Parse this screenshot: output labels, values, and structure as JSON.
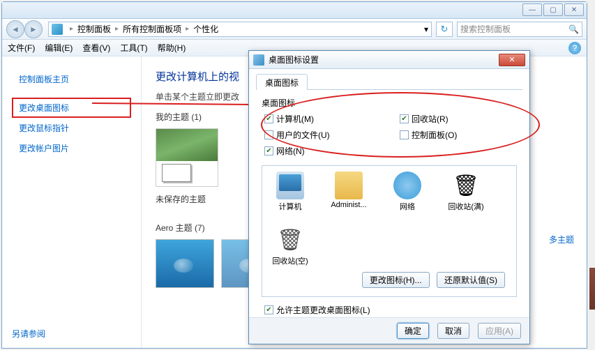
{
  "window": {
    "min": "—",
    "max": "▢",
    "close": "✕"
  },
  "breadcrumb": {
    "items": [
      "控制面板",
      "所有控制面板项",
      "个性化"
    ],
    "dropdown": "▾"
  },
  "search": {
    "placeholder": "搜索控制面板"
  },
  "menu": {
    "file": "文件(F)",
    "edit": "编辑(E)",
    "view": "查看(V)",
    "tools": "工具(T)",
    "help": "帮助(H)"
  },
  "sidebar": {
    "items": [
      {
        "label": "控制面板主页"
      },
      {
        "label": "更改桌面图标"
      },
      {
        "label": "更改鼠标指针"
      },
      {
        "label": "更改帐户图片"
      }
    ],
    "see_also": "另请参阅"
  },
  "page": {
    "title": "更改计算机上的视",
    "subtitle": "单击某个主题立即更改",
    "my_themes": "我的主题 (1)",
    "unsaved": "未保存的主题",
    "aero": "Aero 主题 (7)",
    "more_link": "多主题"
  },
  "dialog": {
    "title": "桌面图标设置",
    "tab": "桌面图标",
    "group": "桌面图标",
    "checkboxes": {
      "computer": {
        "label": "计算机(M)",
        "checked": true
      },
      "recycle": {
        "label": "回收站(R)",
        "checked": true
      },
      "userfiles": {
        "label": "用户的文件(U)",
        "checked": false
      },
      "cpanel": {
        "label": "控制面板(O)",
        "checked": false
      },
      "network": {
        "label": "网络(N)",
        "checked": true
      }
    },
    "icons": [
      {
        "label": "计算机",
        "cls": "ic-computer"
      },
      {
        "label": "Administ...",
        "cls": "ic-folder"
      },
      {
        "label": "网络",
        "cls": "ic-network"
      },
      {
        "label": "回收站(满)",
        "cls": "ic-recycle-full"
      },
      {
        "label": "回收站(空)",
        "cls": "ic-recycle-empty"
      }
    ],
    "change_icon": "更改图标(H)...",
    "restore": "还原默认值(S)",
    "allow_themes": {
      "label": "允许主题更改桌面图标(L)",
      "checked": true
    },
    "ok": "确定",
    "cancel": "取消",
    "apply": "应用(A)"
  }
}
